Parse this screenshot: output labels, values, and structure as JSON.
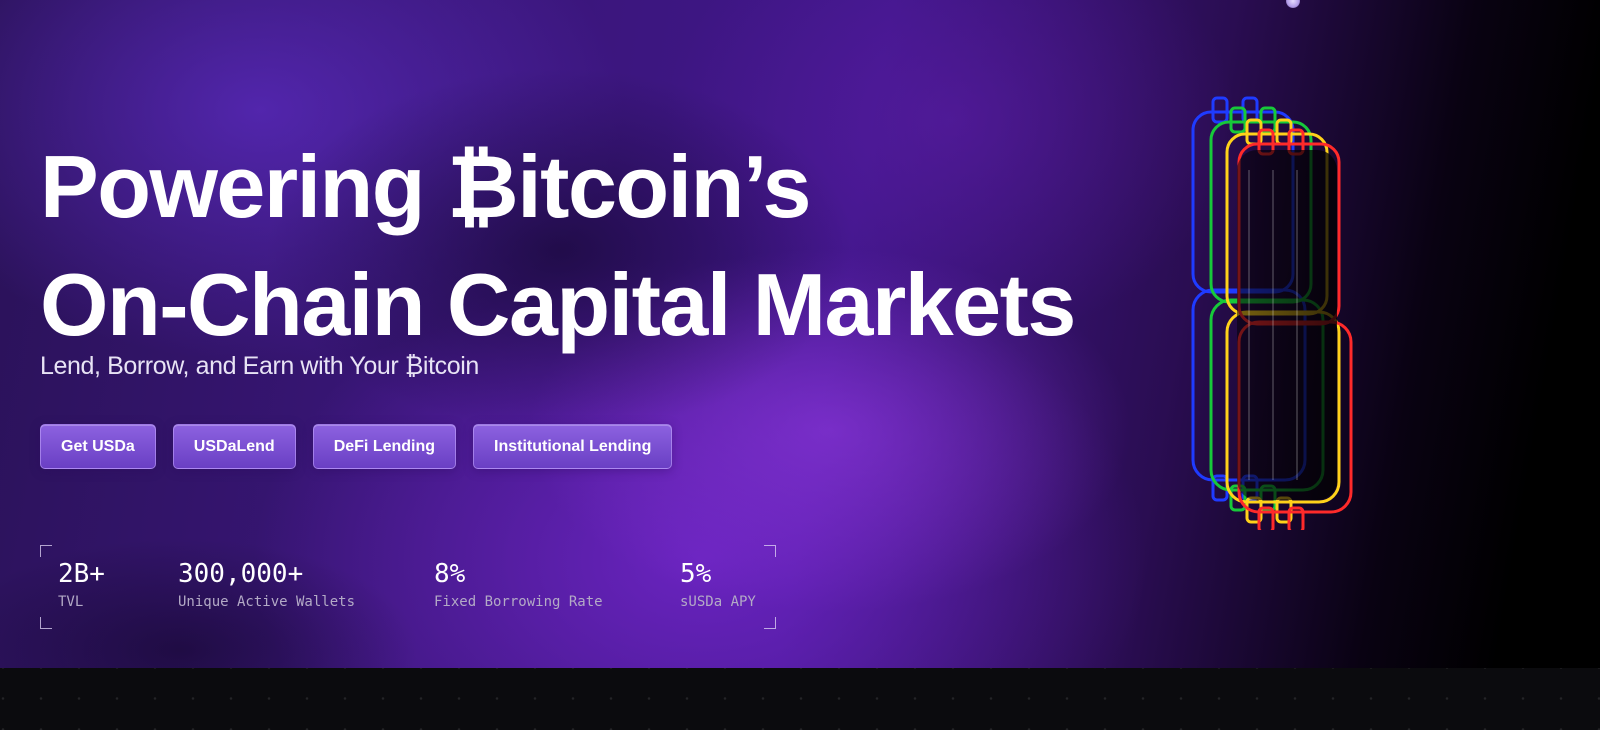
{
  "hero": {
    "title_line1": "Powering ₿itcoin’s",
    "title_line2": "On-Chain Capital Markets",
    "subtitle": "Lend, Borrow, and Earn with Your ₿itcoin"
  },
  "cta": [
    {
      "label": "Get USDa"
    },
    {
      "label": "USDaLend"
    },
    {
      "label": "DeFi Lending"
    },
    {
      "label": "Institutional Lending"
    }
  ],
  "stats": [
    {
      "value": "2B+",
      "label": "TVL"
    },
    {
      "value": "300,000+",
      "label": "Unique Active Wallets"
    },
    {
      "value": "8%",
      "label": "Fixed Borrowing Rate"
    },
    {
      "value": "5%",
      "label": "sUSDa APY"
    }
  ],
  "art": {
    "icon": "bitcoin-3d-icon",
    "colors": [
      "#1f3bff",
      "#17c93a",
      "#ffd21a",
      "#ff2a2a"
    ]
  },
  "theme": {
    "accent": "#7c4fd6",
    "background": "#000000"
  }
}
